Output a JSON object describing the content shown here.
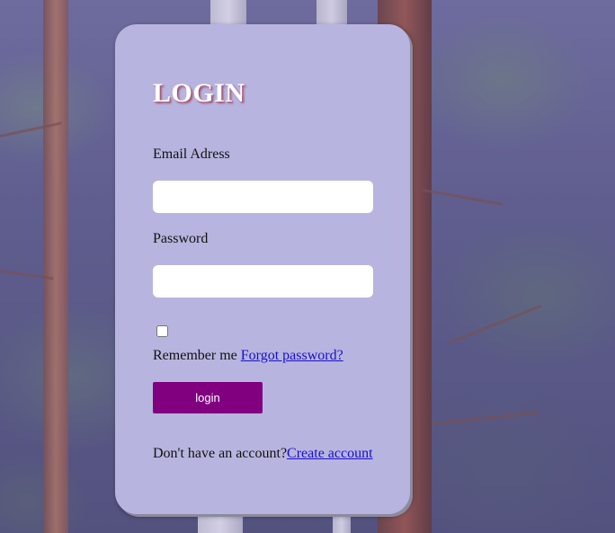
{
  "login_form": {
    "title": "LOGIN",
    "email_label": "Email Adress",
    "email_value": "",
    "password_label": "Password",
    "password_value": "",
    "remember_checked": false,
    "remember_label": "Remember me",
    "forgot_link": "Forgot password?",
    "login_button": "login",
    "signup_prompt": "Don't have an account?",
    "signup_link": "Create account"
  },
  "colors": {
    "card_background": "#b7b5df",
    "button_background": "#800080",
    "link": "#1a0dcc",
    "title": "#ffffff"
  },
  "background": {
    "description_icon": "forest-photo"
  }
}
